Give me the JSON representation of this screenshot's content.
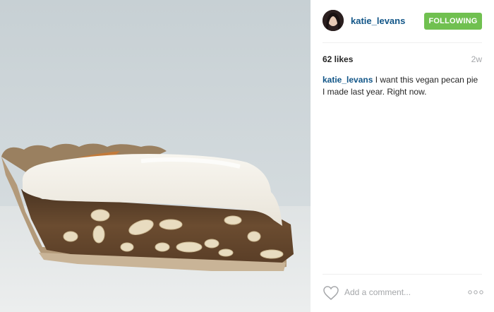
{
  "post": {
    "image": {
      "alt": "slice of vegan pecan pie"
    },
    "header": {
      "username": "katie_levans",
      "follow_label": "FOLLOWING"
    },
    "stats": {
      "likes": "62 likes",
      "time": "2w"
    },
    "caption": {
      "username": "katie_levans",
      "text": " I want this vegan pecan pie I made last year. Right now."
    },
    "footer": {
      "comment_placeholder": "Add a comment...",
      "like_icon": "heart-icon",
      "more_icon": "more-options-icon"
    },
    "colors": {
      "link": "#125688",
      "follow_button": "#70c050",
      "muted": "#a5a7aa"
    }
  }
}
